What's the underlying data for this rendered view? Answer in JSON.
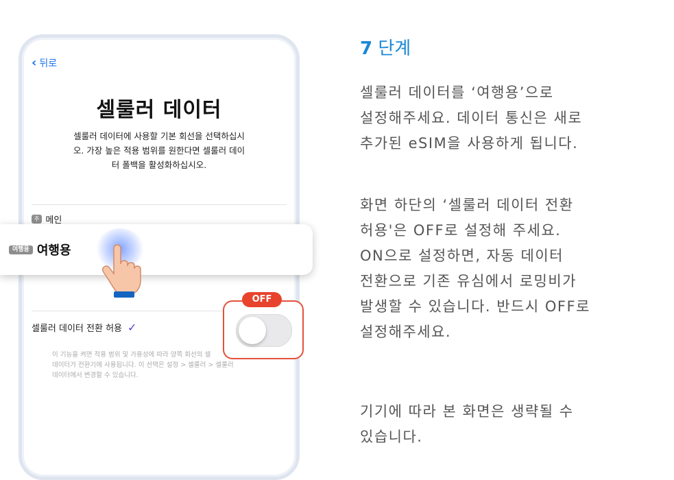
{
  "phone": {
    "back_label": "뒤로",
    "title": "셀룰러 데이터",
    "description_lines": [
      "셀룰러 데이터에 사용할 기본 회선을 선택하십시",
      "오. 가장 높은 적용 범위를 원한다면 셀룰러 데이",
      "터 폴백을 활성화하십시오."
    ],
    "line_main_tag": "주",
    "line_main_label": "메인",
    "line_travel_tag": "여행용",
    "line_travel_label": "여행용",
    "switch_label": "셀룰러 데이터 전환 허용",
    "switch_state_badge": "OFF",
    "small_desc_lines": [
      "이 기능을 켜면 적용 범위 및 가용성에 따라 양쪽 회선의 셀",
      "데이터가 전환기에 사용됩니다. 이 선택은 설정 > 셀룰러 > 셀룰러",
      "데이터에서 변경할 수 있습니다."
    ]
  },
  "instructions": {
    "step_number": "7",
    "step_word": "단계",
    "paragraph1": [
      "셀룰러 데이터를 ‘여행용’으로",
      "설정해주세요. 데이터 통신은 새로",
      "추가된 eSIM을 사용하게 됩니다."
    ],
    "paragraph2": [
      "화면 하단의 ‘셀룰러 데이터 전환",
      "허용'은 OFF로 설정해 주세요.",
      "ON으로 설정하면, 자동 데이터",
      "전환으로 기존 유심에서 로밍비가",
      "발생할 수 있습니다. 반드시 OFF로",
      "설정해주세요."
    ],
    "paragraph3": [
      "기기에 따라 본 화면은 생략될 수",
      "있습니다."
    ]
  },
  "colors": {
    "accent_blue": "#1a88d6",
    "off_red": "#e8432d",
    "check_purple": "#5a3fd6"
  },
  "icons": [
    "chevron-left-icon",
    "checkmark-icon",
    "pointing-hand-icon"
  ]
}
